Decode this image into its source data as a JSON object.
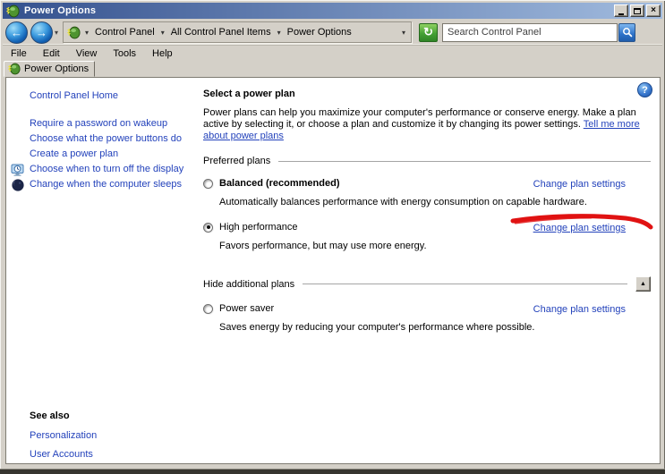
{
  "window": {
    "title": "Power Options"
  },
  "icons": {
    "chevron": "▾",
    "back": "←",
    "forward": "→",
    "refresh": "↻",
    "close": "×",
    "up": "▲",
    "help": "?"
  },
  "toolbar": {
    "breadcrumb": {
      "items": [
        "Control Panel",
        "All Control Panel Items",
        "Power Options"
      ]
    },
    "search": {
      "placeholder": "Search Control Panel"
    }
  },
  "menubar": {
    "items": [
      "File",
      "Edit",
      "View",
      "Tools",
      "Help"
    ]
  },
  "tabs": {
    "active": "Power Options"
  },
  "sidebar": {
    "home": "Control Panel Home",
    "tasks": [
      {
        "label": "Require a password on wakeup"
      },
      {
        "label": "Choose what the power buttons do"
      },
      {
        "label": "Create a power plan"
      },
      {
        "label": "Choose when to turn off the display",
        "icon": "display-clock"
      },
      {
        "label": "Change when the computer sleeps",
        "icon": "sleep-moon"
      }
    ],
    "see_also": {
      "heading": "See also",
      "links": [
        "Personalization",
        "User Accounts"
      ]
    }
  },
  "main": {
    "heading": "Select a power plan",
    "intro": "Power plans can help you maximize your computer's performance or conserve energy. Make a plan active by selecting it, or choose a plan and customize it by changing its power settings. ",
    "intro_link": "Tell me more about power plans",
    "groups": {
      "preferred": "Preferred plans",
      "hide": "Hide additional plans"
    },
    "plans": [
      {
        "name": "Balanced (recommended)",
        "selected": false,
        "description": "Automatically balances performance with energy consumption on capable hardware.",
        "link": "Change plan settings"
      },
      {
        "name": "High performance",
        "selected": true,
        "description": "Favors performance, but may use more energy.",
        "link": "Change plan settings"
      },
      {
        "name": "Power saver",
        "selected": false,
        "description": "Saves energy by reducing your computer's performance where possible.",
        "link": "Change plan settings"
      }
    ]
  },
  "colors": {
    "titlebar_left": "#34518e",
    "titlebar_right": "#a2bcdf",
    "chrome": "#d4d0c8",
    "link_blue": "#2342bb",
    "annotation_red": "#e01212"
  }
}
